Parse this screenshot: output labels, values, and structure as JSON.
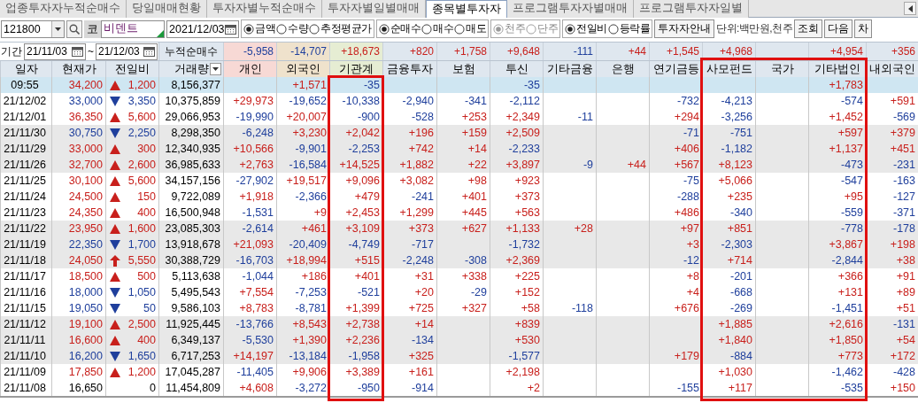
{
  "tabs": [
    {
      "label": "업종투자자누적순매수",
      "selected": false
    },
    {
      "label": "당일매매현황",
      "selected": false
    },
    {
      "label": "투자자별누적순매수",
      "selected": false
    },
    {
      "label": "투자자별일별매매",
      "selected": false
    },
    {
      "label": "종목별투자자",
      "selected": true
    },
    {
      "label": "프로그램투자자별매매",
      "selected": false
    },
    {
      "label": "프로그램투자자일별",
      "selected": false
    }
  ],
  "toolbar": {
    "code": "121800",
    "market": "코",
    "name": "비덴트",
    "date": "2021/12/03",
    "radio_groups": [
      {
        "disabled": false,
        "options": [
          {
            "label": "금액",
            "selected": true
          },
          {
            "label": "수량",
            "selected": false
          },
          {
            "label": "추정평균가",
            "selected": false
          }
        ]
      },
      {
        "disabled": false,
        "options": [
          {
            "label": "순매수",
            "selected": true
          },
          {
            "label": "매수",
            "selected": false
          },
          {
            "label": "매도",
            "selected": false
          }
        ]
      },
      {
        "disabled": true,
        "options": [
          {
            "label": "천주",
            "selected": true
          },
          {
            "label": "단주",
            "selected": false
          }
        ]
      },
      {
        "disabled": false,
        "options": [
          {
            "label": "전일비",
            "selected": true
          },
          {
            "label": "등락률",
            "selected": false
          }
        ]
      }
    ],
    "guide_button": "투자자안내",
    "unit": "단위:백만원,천주",
    "buttons": [
      "조회",
      "다음",
      "차"
    ]
  },
  "period": {
    "label": "기간",
    "from": "21/11/03",
    "separator": "~",
    "to": "21/12/03",
    "sum_label": "누적순매수"
  },
  "columns": [
    {
      "label": "일자",
      "highlighted": false
    },
    {
      "label": "현재가",
      "highlighted": false
    },
    {
      "label": "전일비",
      "highlighted": false
    },
    {
      "label": "거래량",
      "highlighted": false
    },
    {
      "label": "개인",
      "highlighted": false,
      "color": "#f7d9d5",
      "total": "-5,958"
    },
    {
      "label": "외국인",
      "highlighted": false,
      "color": "#efe2cc",
      "total": "-14,707"
    },
    {
      "label": "기관계",
      "highlighted": true,
      "color": "#e6edd3",
      "total": "+18,673"
    },
    {
      "label": "금융투자",
      "highlighted": false,
      "total": "+820"
    },
    {
      "label": "보험",
      "highlighted": false,
      "total": "+1,758"
    },
    {
      "label": "투신",
      "highlighted": false,
      "total": "+9,648"
    },
    {
      "label": "기타금융",
      "highlighted": false,
      "total": "-111"
    },
    {
      "label": "은행",
      "highlighted": false,
      "total": "+44"
    },
    {
      "label": "연기금등",
      "highlighted": false,
      "total": "+1,545"
    },
    {
      "label": "사모펀드",
      "highlighted": true,
      "total": "+4,968"
    },
    {
      "label": "국가",
      "highlighted": true
    },
    {
      "label": "기타법인",
      "highlighted": true,
      "total": "+4,954"
    },
    {
      "label": "내외국인",
      "highlighted": false,
      "total": "+356"
    }
  ],
  "rows": [
    {
      "current": true,
      "shaded": false,
      "kind": "up",
      "date": "09:55",
      "price": "34,200",
      "diff": "1,200",
      "volume": "8,156,377",
      "investors": {
        "foreign": "+1,571",
        "institution": "-35",
        "trust": "-35",
        "other_corp": "+1,783"
      }
    },
    {
      "current": false,
      "shaded": false,
      "kind": "down",
      "date": "21/12/02",
      "price": "33,000",
      "diff": "3,350",
      "volume": "10,375,859",
      "investors": {
        "individual": "+29,973",
        "foreign": "-19,652",
        "institution": "-10,338",
        "financial": "-2,940",
        "insurance": "-341",
        "trust": "-2,112",
        "pension": "-732",
        "private_fund": "-4,213",
        "other_corp": "-574",
        "domestic_foreign": "+591"
      }
    },
    {
      "current": false,
      "shaded": false,
      "kind": "up",
      "date": "21/12/01",
      "price": "36,350",
      "diff": "5,600",
      "volume": "29,066,953",
      "investors": {
        "individual": "-19,990",
        "foreign": "+20,007",
        "institution": "-900",
        "financial": "-528",
        "insurance": "+253",
        "trust": "+2,349",
        "other_finance": "-11",
        "pension": "+294",
        "private_fund": "-3,256",
        "other_corp": "+1,452",
        "domestic_foreign": "-569"
      }
    },
    {
      "current": false,
      "shaded": true,
      "kind": "down",
      "date": "21/11/30",
      "price": "30,750",
      "diff": "2,250",
      "volume": "8,298,350",
      "investors": {
        "individual": "-6,248",
        "foreign": "+3,230",
        "institution": "+2,042",
        "financial": "+196",
        "insurance": "+159",
        "trust": "+2,509",
        "pension": "-71",
        "private_fund": "-751",
        "other_corp": "+597",
        "domestic_foreign": "+379"
      }
    },
    {
      "current": false,
      "shaded": true,
      "kind": "up",
      "date": "21/11/29",
      "price": "33,000",
      "diff": "300",
      "volume": "12,340,935",
      "investors": {
        "individual": "+10,566",
        "foreign": "-9,901",
        "institution": "-2,253",
        "financial": "+742",
        "insurance": "+14",
        "trust": "-2,233",
        "pension": "+406",
        "private_fund": "-1,182",
        "other_corp": "+1,137",
        "domestic_foreign": "+451"
      }
    },
    {
      "current": false,
      "shaded": true,
      "kind": "up",
      "date": "21/11/26",
      "price": "32,700",
      "diff": "2,600",
      "volume": "36,985,633",
      "investors": {
        "individual": "+2,763",
        "foreign": "-16,584",
        "institution": "+14,525",
        "financial": "+1,882",
        "insurance": "+22",
        "trust": "+3,897",
        "other_finance": "-9",
        "bank": "+44",
        "pension": "+567",
        "private_fund": "+8,123",
        "other_corp": "-473",
        "domestic_foreign": "-231"
      }
    },
    {
      "current": false,
      "shaded": false,
      "kind": "up",
      "date": "21/11/25",
      "price": "30,100",
      "diff": "5,600",
      "volume": "34,157,156",
      "investors": {
        "individual": "-27,902",
        "foreign": "+19,517",
        "institution": "+9,096",
        "financial": "+3,082",
        "insurance": "+98",
        "trust": "+923",
        "pension": "-75",
        "private_fund": "+5,066",
        "other_corp": "-547",
        "domestic_foreign": "-163"
      }
    },
    {
      "current": false,
      "shaded": false,
      "kind": "up",
      "date": "21/11/24",
      "price": "24,500",
      "diff": "150",
      "volume": "9,722,089",
      "investors": {
        "individual": "+1,918",
        "foreign": "-2,366",
        "institution": "+479",
        "financial": "-241",
        "insurance": "+401",
        "trust": "+373",
        "pension": "-288",
        "private_fund": "+235",
        "other_corp": "+95",
        "domestic_foreign": "-127"
      }
    },
    {
      "current": false,
      "shaded": false,
      "kind": "up",
      "date": "21/11/23",
      "price": "24,350",
      "diff": "400",
      "volume": "16,500,948",
      "investors": {
        "individual": "-1,531",
        "foreign": "+9",
        "institution": "+2,453",
        "financial": "+1,299",
        "insurance": "+445",
        "trust": "+563",
        "pension": "+486",
        "private_fund": "-340",
        "other_corp": "-559",
        "domestic_foreign": "-371"
      }
    },
    {
      "current": false,
      "shaded": true,
      "kind": "up",
      "date": "21/11/22",
      "price": "23,950",
      "diff": "1,600",
      "volume": "23,085,303",
      "investors": {
        "individual": "-2,614",
        "foreign": "+461",
        "institution": "+3,109",
        "financial": "+373",
        "insurance": "+627",
        "trust": "+1,133",
        "other_finance": "+28",
        "pension": "+97",
        "private_fund": "+851",
        "other_corp": "-778",
        "domestic_foreign": "-178"
      }
    },
    {
      "current": false,
      "shaded": true,
      "kind": "down",
      "date": "21/11/19",
      "price": "22,350",
      "diff": "1,700",
      "volume": "13,918,678",
      "investors": {
        "individual": "+21,093",
        "foreign": "-20,409",
        "institution": "-4,749",
        "financial": "-717",
        "trust": "-1,732",
        "pension": "+3",
        "private_fund": "-2,303",
        "other_corp": "+3,867",
        "domestic_foreign": "+198"
      }
    },
    {
      "current": false,
      "shaded": true,
      "kind": "limit_up",
      "date": "21/11/18",
      "price": "24,050",
      "diff": "5,550",
      "volume": "30,388,729",
      "investors": {
        "individual": "-16,703",
        "foreign": "+18,994",
        "institution": "+515",
        "financial": "-2,248",
        "insurance": "-308",
        "trust": "+2,369",
        "pension": "-12",
        "private_fund": "+714",
        "other_corp": "-2,844",
        "domestic_foreign": "+38"
      }
    },
    {
      "current": false,
      "shaded": false,
      "kind": "up",
      "date": "21/11/17",
      "price": "18,500",
      "diff": "500",
      "volume": "5,113,638",
      "investors": {
        "individual": "-1,044",
        "foreign": "+186",
        "institution": "+401",
        "financial": "+31",
        "insurance": "+338",
        "trust": "+225",
        "pension": "+8",
        "private_fund": "-201",
        "other_corp": "+366",
        "domestic_foreign": "+91"
      }
    },
    {
      "current": false,
      "shaded": false,
      "kind": "down",
      "date": "21/11/16",
      "price": "18,000",
      "diff": "1,050",
      "volume": "5,495,543",
      "investors": {
        "individual": "+7,554",
        "foreign": "-7,253",
        "institution": "-521",
        "financial": "+20",
        "insurance": "-29",
        "trust": "+152",
        "pension": "+4",
        "private_fund": "-668",
        "other_corp": "+131",
        "domestic_foreign": "+89"
      }
    },
    {
      "current": false,
      "shaded": false,
      "kind": "down",
      "date": "21/11/15",
      "price": "19,050",
      "diff": "50",
      "volume": "9,586,103",
      "investors": {
        "individual": "+8,783",
        "foreign": "-8,781",
        "institution": "+1,399",
        "financial": "+725",
        "insurance": "+327",
        "trust": "+58",
        "other_finance": "-118",
        "pension": "+676",
        "private_fund": "-269",
        "other_corp": "-1,451",
        "domestic_foreign": "+51"
      }
    },
    {
      "current": false,
      "shaded": true,
      "kind": "up",
      "date": "21/11/12",
      "price": "19,100",
      "diff": "2,500",
      "volume": "11,925,445",
      "investors": {
        "individual": "-13,766",
        "foreign": "+8,543",
        "institution": "+2,738",
        "financial": "+14",
        "trust": "+839",
        "private_fund": "+1,885",
        "other_corp": "+2,616",
        "domestic_foreign": "-131"
      }
    },
    {
      "current": false,
      "shaded": true,
      "kind": "up",
      "date": "21/11/11",
      "price": "16,600",
      "diff": "400",
      "volume": "6,349,137",
      "investors": {
        "individual": "-5,530",
        "foreign": "+1,390",
        "institution": "+2,236",
        "financial": "-134",
        "trust": "+530",
        "private_fund": "+1,840",
        "other_corp": "+1,850",
        "domestic_foreign": "+54"
      }
    },
    {
      "current": false,
      "shaded": true,
      "kind": "down",
      "date": "21/11/10",
      "price": "16,200",
      "diff": "1,650",
      "volume": "6,717,253",
      "investors": {
        "individual": "+14,197",
        "foreign": "-13,184",
        "institution": "-1,958",
        "financial": "+325",
        "trust": "-1,577",
        "pension": "+179",
        "private_fund": "-884",
        "other_corp": "+773",
        "domestic_foreign": "+172"
      }
    },
    {
      "current": false,
      "shaded": false,
      "kind": "up",
      "date": "21/11/09",
      "price": "17,850",
      "diff": "1,200",
      "volume": "17,045,287",
      "investors": {
        "individual": "-11,405",
        "foreign": "+9,906",
        "institution": "+3,389",
        "financial": "+161",
        "trust": "+2,198",
        "private_fund": "+1,030",
        "other_corp": "-1,462",
        "domestic_foreign": "-428"
      }
    },
    {
      "current": false,
      "shaded": false,
      "kind": "flat",
      "date": "21/11/08",
      "price": "16,650",
      "diff": "0",
      "volume": "11,454,809",
      "investors": {
        "individual": "+4,608",
        "foreign": "-3,272",
        "institution": "-950",
        "financial": "-914",
        "trust": "+2",
        "pension": "-155",
        "private_fund": "+117",
        "other_corp": "-535",
        "domestic_foreign": "+150"
      }
    }
  ]
}
